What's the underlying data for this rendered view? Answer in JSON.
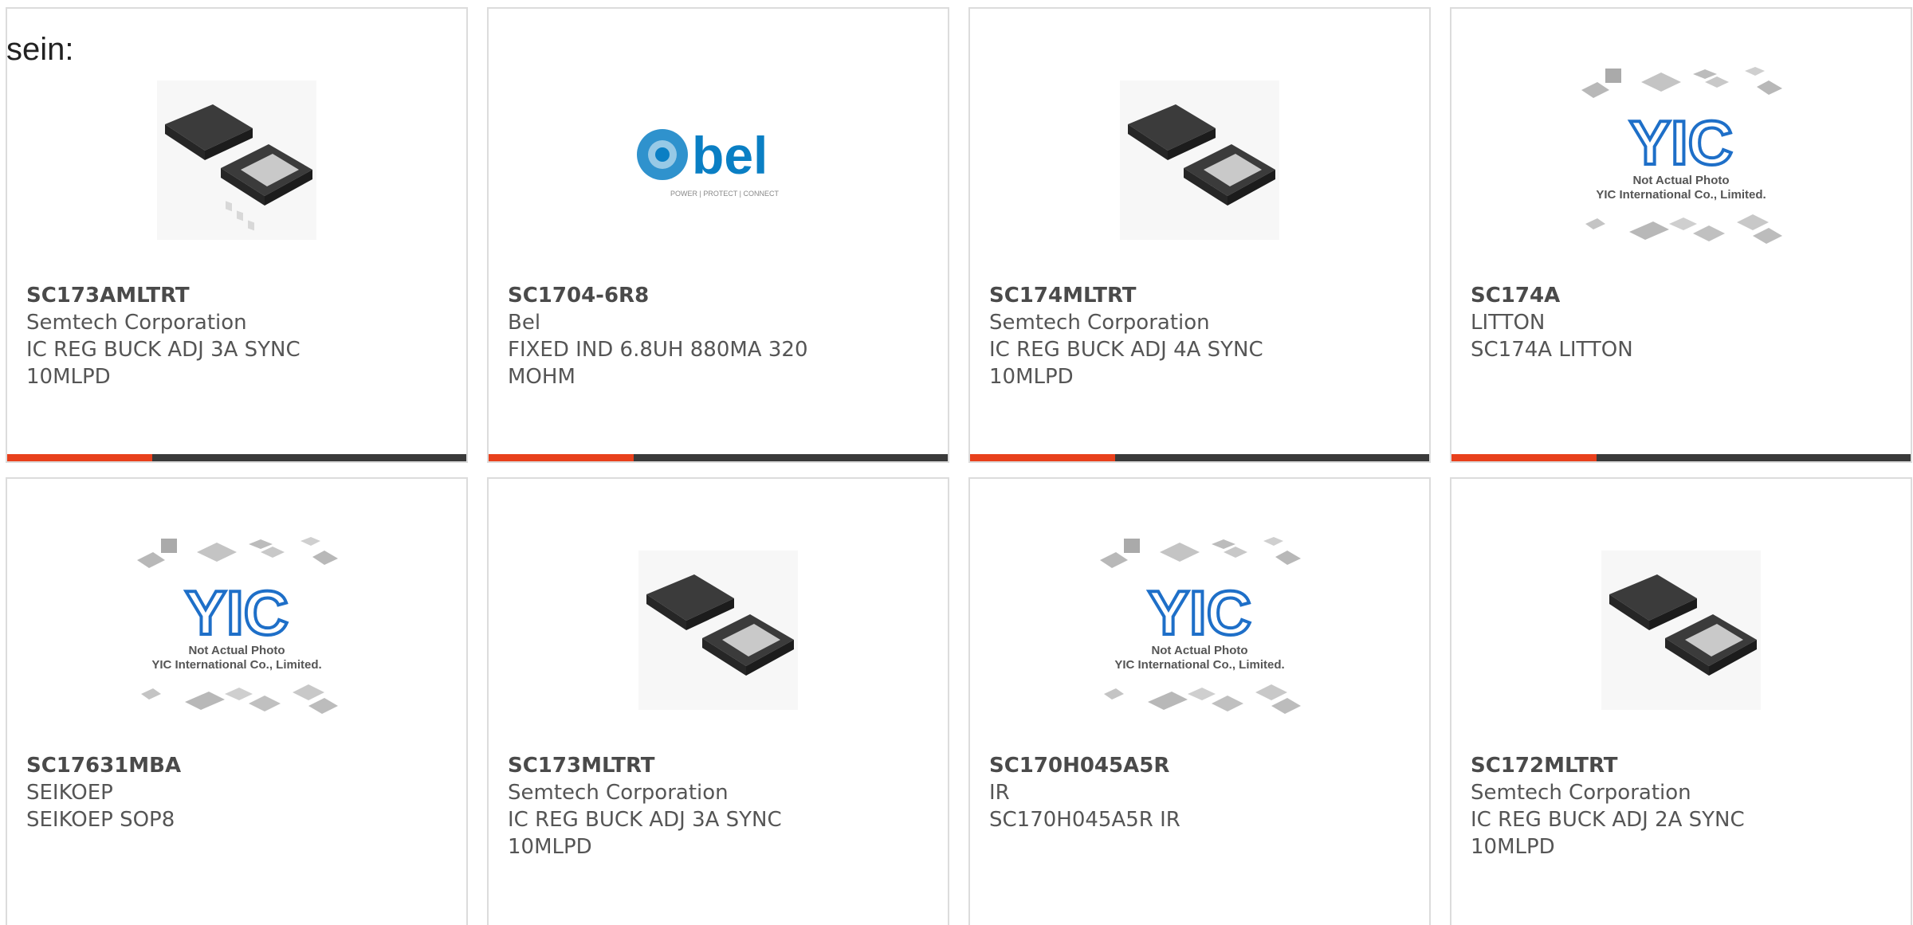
{
  "page": {
    "heading_fragment": "sein:"
  },
  "colors": {
    "accent": "#e8401c",
    "bar": "#3a3a3a",
    "bel_blue": "#0a7fc4",
    "yic_blue": "#1e6fc8"
  },
  "products": [
    {
      "part_number": "SC173AMLTRT",
      "manufacturer": "Semtech Corporation",
      "description": "IC REG BUCK ADJ 3A SYNC 10MLPD",
      "image": "qfn-chip-photo"
    },
    {
      "part_number": "SC1704-6R8",
      "manufacturer": "Bel",
      "description": "FIXED IND 6.8UH 880MA 320 MOHM",
      "image": "bel-logo",
      "logo_text": "bel",
      "logo_tagline": "POWER | PROTECT | CONNECT"
    },
    {
      "part_number": "SC174MLTRT",
      "manufacturer": "Semtech Corporation",
      "description": "IC REG BUCK ADJ 4A SYNC 10MLPD",
      "image": "qfn-chip-photo"
    },
    {
      "part_number": "SC174A",
      "manufacturer": "LITTON",
      "description": "SC174A LITTON",
      "image": "yic-placeholder",
      "placeholder_line1": "Not Actual Photo",
      "placeholder_line2": "YIC International Co., Limited."
    },
    {
      "part_number": "SC17631MBA",
      "manufacturer": "SEIKOEP",
      "description": "SEIKOEP SOP8",
      "image": "yic-placeholder",
      "placeholder_line1": "Not Actual Photo",
      "placeholder_line2": "YIC International Co., Limited."
    },
    {
      "part_number": "SC173MLTRT",
      "manufacturer": "Semtech Corporation",
      "description": "IC REG BUCK ADJ 3A SYNC 10MLPD",
      "image": "qfn-chip-photo"
    },
    {
      "part_number": "SC170H045A5R",
      "manufacturer": "IR",
      "description": "SC170H045A5R IR",
      "image": "yic-placeholder",
      "placeholder_line1": "Not Actual Photo",
      "placeholder_line2": "YIC International Co., Limited."
    },
    {
      "part_number": "SC172MLTRT",
      "manufacturer": "Semtech Corporation",
      "description": "IC REG BUCK ADJ 2A SYNC 10MLPD",
      "image": "qfn-chip-photo"
    }
  ]
}
